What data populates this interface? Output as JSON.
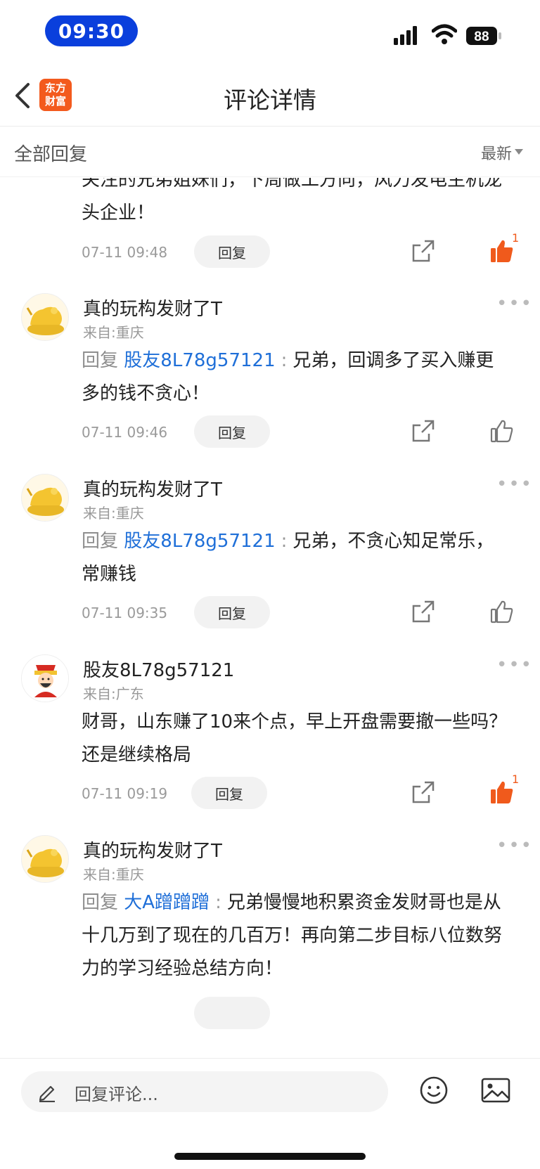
{
  "status_bar": {
    "time": "09:30",
    "battery": "88"
  },
  "nav": {
    "logo_line1": "东方",
    "logo_line2": "财富",
    "title": "评论详情"
  },
  "subheader": {
    "label": "全部回复",
    "sort": "最新"
  },
  "comments": [
    {
      "text": "关注的兄弟姐妹们，下周做工方向，风力发电主机龙头企业！",
      "time": "07-11 09:48",
      "reply_label": "回复",
      "liked": true,
      "like_count": "1"
    },
    {
      "user": "真的玩构发财了T",
      "location": "来自:重庆",
      "reply_kw": "回复",
      "reply_to": "股友8L78g57121",
      "separator": ":",
      "text": "兄弟，回调多了买入赚更多的钱不贪心！",
      "time": "07-11 09:46",
      "reply_label": "回复",
      "liked": false
    },
    {
      "user": "真的玩构发财了T",
      "location": "来自:重庆",
      "reply_kw": "回复",
      "reply_to": "股友8L78g57121",
      "separator": ":",
      "text": "兄弟，不贪心知足常乐，常赚钱",
      "time": "07-11 09:35",
      "reply_label": "回复",
      "liked": false
    },
    {
      "user": "股友8L78g57121",
      "location": "来自:广东",
      "text": "财哥，山东赚了10来个点，早上开盘需要撤一些吗？还是继续格局",
      "time": "07-11 09:19",
      "reply_label": "回复",
      "liked": true,
      "like_count": "1"
    },
    {
      "user": "真的玩构发财了T",
      "location": "来自:重庆",
      "reply_kw": "回复",
      "reply_to": "大A蹭蹭蹭",
      "separator": ":",
      "text": "兄弟慢慢地积累资金发财哥也是从十几万到了现在的几百万！再向第二步目标八位数努力的学习经验总结方向！"
    }
  ],
  "bottom": {
    "placeholder": "回复评论..."
  },
  "colors": {
    "accent": "#f05a1c",
    "link": "#1f6fd8",
    "time_pill": "#0a3fdc"
  }
}
